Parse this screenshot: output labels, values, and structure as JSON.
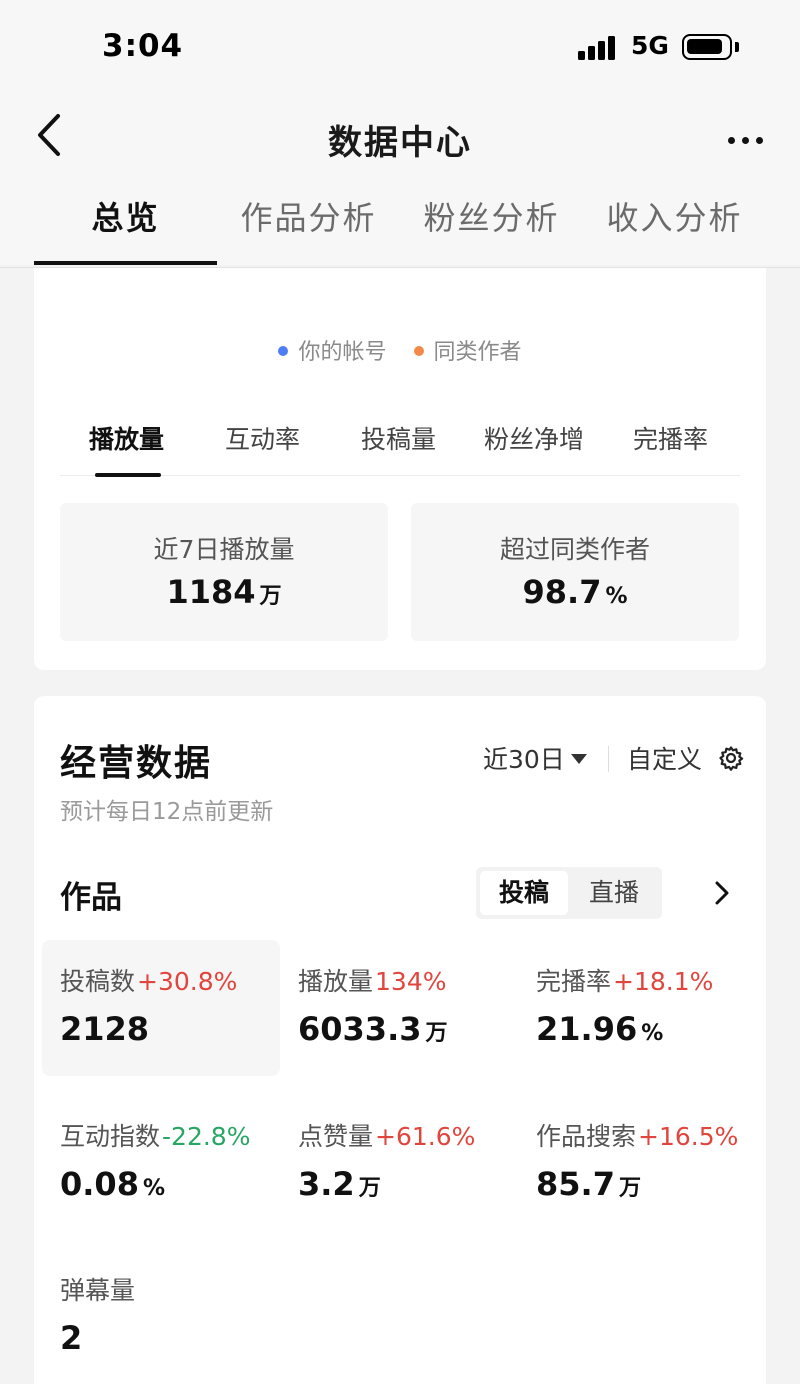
{
  "status": {
    "time": "3:04",
    "network": "5G"
  },
  "header": {
    "title": "数据中心",
    "tabs": [
      {
        "label": "总览"
      },
      {
        "label": "作品分析"
      },
      {
        "label": "粉丝分析"
      },
      {
        "label": "收入分析"
      }
    ]
  },
  "compare_card": {
    "legend": [
      {
        "label": "你的帐号",
        "color": "#4f7ef3"
      },
      {
        "label": "同类作者",
        "color": "#f5894a"
      }
    ],
    "metric_tabs": [
      "播放量",
      "互动率",
      "投稿量",
      "粉丝净增",
      "完播率"
    ],
    "stats": [
      {
        "label": "近7日播放量",
        "value": "1184",
        "unit": "万"
      },
      {
        "label": "超过同类作者",
        "value": "98.7",
        "unit": "%"
      }
    ]
  },
  "operations": {
    "title": "经营数据",
    "subtitle": "预计每日12点前更新",
    "range": "近30日",
    "custom": "自定义",
    "works_title": "作品",
    "segment": [
      "投稿",
      "直播"
    ],
    "metrics": [
      {
        "label": "投稿数",
        "delta": "+30.8%",
        "trend": "up",
        "value": "2128",
        "unit": ""
      },
      {
        "label": "播放量",
        "delta": "134%",
        "trend": "up",
        "value": "6033.3",
        "unit": "万"
      },
      {
        "label": "完播率",
        "delta": "+18.1%",
        "trend": "up",
        "value": "21.96",
        "unit": "%"
      },
      {
        "label": "互动指数",
        "delta": "-22.8%",
        "trend": "down",
        "value": "0.08",
        "unit": "%"
      },
      {
        "label": "点赞量",
        "delta": "+61.6%",
        "trend": "up",
        "value": "3.2",
        "unit": "万"
      },
      {
        "label": "作品搜索",
        "delta": "+16.5%",
        "trend": "up",
        "value": "85.7",
        "unit": "万"
      },
      {
        "label": "弹幕量",
        "delta": "",
        "trend": "",
        "value": "2",
        "unit": ""
      }
    ]
  },
  "colors": {
    "accent_up": "#e0463d",
    "accent_down": "#2aa664"
  }
}
